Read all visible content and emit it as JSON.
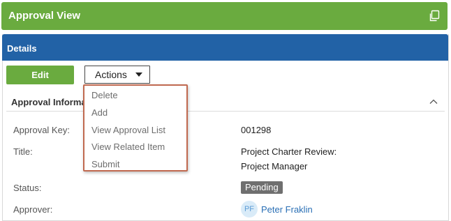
{
  "window": {
    "title": "Approval View",
    "popout_icon": "popout-icon"
  },
  "panel": {
    "title": "Details"
  },
  "toolbar": {
    "edit_label": "Edit",
    "actions_label": "Actions",
    "actions_menu": [
      "Delete",
      "Add",
      "View Approval List",
      "View Related Item",
      "Submit"
    ]
  },
  "section": {
    "title": "Approval Information"
  },
  "fields": {
    "approval_key": {
      "label": "Approval Key:",
      "value": "001298"
    },
    "title": {
      "label": "Title:",
      "value_line1": "Project Charter Review:",
      "value_line2": "Project Manager"
    },
    "status": {
      "label": "Status:",
      "value": "Pending"
    },
    "approver": {
      "label": "Approver:",
      "initials": "PF",
      "name": "Peter Fraklin"
    }
  },
  "colors": {
    "title_bar": "#6aab3f",
    "panel_header": "#2262a6",
    "edit_button": "#6aab3f",
    "dropdown_border": "#c0694f",
    "status_badge": "#6f6f6f",
    "link": "#2a6fb5"
  }
}
